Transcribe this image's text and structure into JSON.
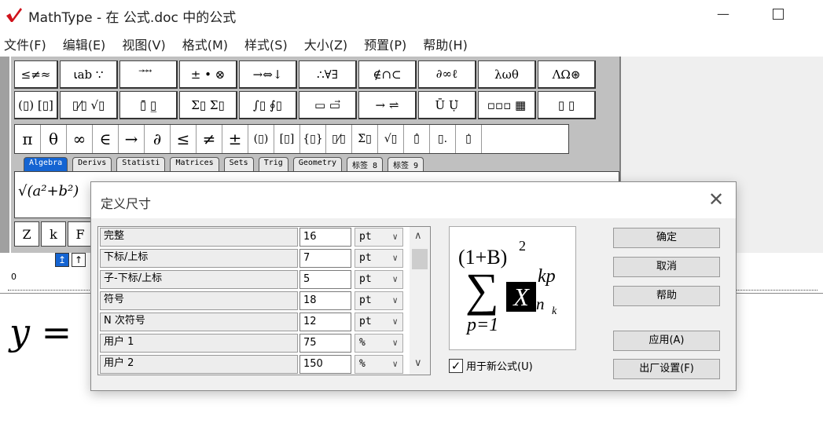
{
  "window": {
    "title": "MathType - 在 公式.doc 中的公式",
    "minimize_glyph": "—",
    "logo_icon": "mathtype-logo-icon"
  },
  "menu": [
    "文件(F)",
    "编辑(E)",
    "视图(V)",
    "格式(M)",
    "样式(S)",
    "大小(Z)",
    "预置(P)",
    "帮助(H)"
  ],
  "toolbar": {
    "row1": [
      "≤≠≈",
      "⍳ab ∵",
      "⃗ ⃗ ⃗",
      "± • ⊗",
      "→⇔↓",
      "∴∀∃",
      "∉∩⊂",
      "∂∞ℓ",
      "λωθ",
      "ΛΩ⊛"
    ],
    "row2": [
      "(▯) [▯]",
      "▯⁄▯ √▯",
      "▯̄ ▯̲",
      "Σ▯ Σ▯",
      "∫▯ ∮▯",
      "▭ ▭⃗",
      "→ ⇌",
      "Ū Ụ̇",
      "▫▫▫ ▦",
      "▯ ▯"
    ],
    "row3": [
      "π",
      "θ",
      "∞",
      "∈",
      "→",
      "∂",
      "≤",
      "≠",
      "±",
      "(▯)",
      "[▯]",
      "{▯}",
      "▯⁄▯",
      "Σ̇▯",
      "√▯",
      "▯̂",
      "▯.",
      "▯̇"
    ],
    "tabs": [
      "Algebra",
      "Derivs",
      "Statisti",
      "Matrices",
      "Sets",
      "Trig",
      "Geometry",
      "标签 8",
      "标签 9"
    ],
    "active_tab": "Algebra",
    "palette_sample": "√(a²+b²)",
    "row5": [
      "Z",
      "k",
      "F"
    ]
  },
  "size_buttons": [
    "↥",
    "↑"
  ],
  "ruler_zero": "0",
  "equation": {
    "var": "y",
    "op": "="
  },
  "dialog": {
    "title": "定义尺寸",
    "rows": [
      {
        "label": "完整",
        "value": "16",
        "unit": "pt"
      },
      {
        "label": "下标/上标",
        "value": "7",
        "unit": "pt"
      },
      {
        "label": "子-下标/上标",
        "value": "5",
        "unit": "pt"
      },
      {
        "label": "符号",
        "value": "18",
        "unit": "pt"
      },
      {
        "label": "N 次符号",
        "value": "12",
        "unit": "pt"
      },
      {
        "label": "用户 1",
        "value": "75",
        "unit": "%"
      },
      {
        "label": "用户 2",
        "value": "150",
        "unit": "%"
      }
    ],
    "preview": {
      "paren": "(1+B)",
      "power": "2",
      "sum": "∑",
      "center": "X",
      "sup": "kp",
      "sub": "n",
      "subsub": "k",
      "lower": "p=1"
    },
    "checkbox": {
      "checked": true,
      "label": "用于新公式(U)"
    },
    "buttons": {
      "ok": "确定",
      "cancel": "取消",
      "help": "帮助",
      "apply": "应用(A)",
      "factory": "出厂设置(F)"
    }
  }
}
